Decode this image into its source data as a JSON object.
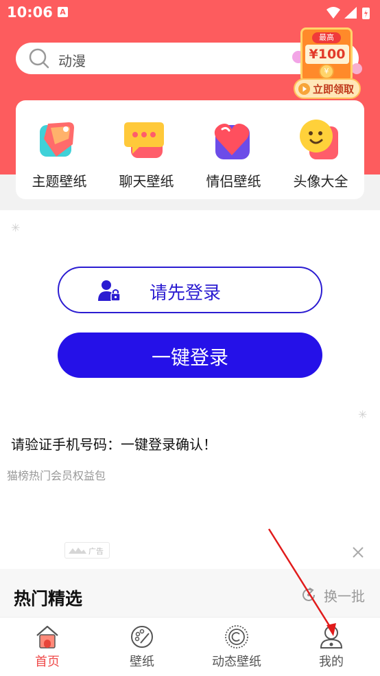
{
  "status_bar": {
    "time": "10:06",
    "notification_glyph": "A"
  },
  "search": {
    "text": "动漫"
  },
  "promo": {
    "top_label": "最高",
    "amount": "¥100",
    "coin": "¥",
    "button": "立即领取"
  },
  "categories": [
    {
      "label": "主题壁纸",
      "icon": "tag-icon"
    },
    {
      "label": "聊天壁纸",
      "icon": "chat-bubble-icon"
    },
    {
      "label": "情侣壁纸",
      "icon": "heart-icon"
    },
    {
      "label": "头像大全",
      "icon": "smiley-icon"
    }
  ],
  "login": {
    "prompt_button": "请先登录",
    "one_key_button": "一键登录",
    "verify_text": "请验证手机号码：一键登录确认！"
  },
  "ad": {
    "title": "猫榜热门会员权益包",
    "badge": "广告"
  },
  "hot": {
    "title": "热门精选",
    "refresh": "换一批"
  },
  "bottom_nav": [
    {
      "label": "首页",
      "icon": "home-icon",
      "active": true
    },
    {
      "label": "壁纸",
      "icon": "palette-icon",
      "active": false
    },
    {
      "label": "动态壁纸",
      "icon": "live-wallpaper-icon",
      "active": false
    },
    {
      "label": "我的",
      "icon": "profile-icon",
      "active": false
    }
  ],
  "colors": {
    "brand_red": "#fd5c5e",
    "login_blue": "#2511e8",
    "active_nav": "#ef4a4a"
  }
}
